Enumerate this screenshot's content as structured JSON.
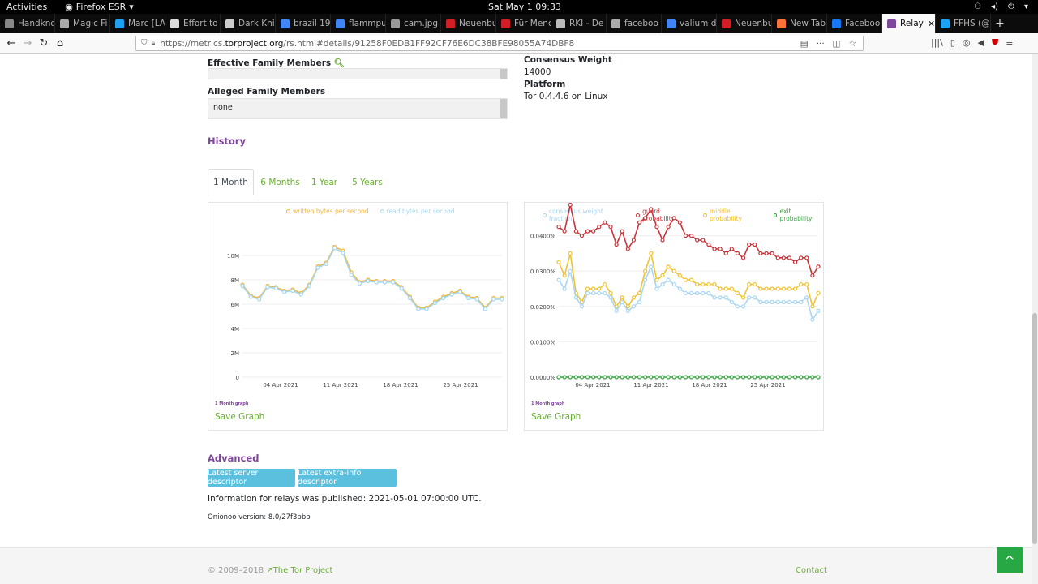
{
  "system": {
    "activities": "Activities",
    "app": "Firefox ESR",
    "clock": "Sat May 1  09:33"
  },
  "tabs": [
    {
      "label": "Handkno",
      "color": "#888"
    },
    {
      "label": "Magic Fi",
      "color": "#aaa"
    },
    {
      "label": "Marc [LA",
      "color": "#1da1f2"
    },
    {
      "label": "Effort to",
      "color": "#ddd"
    },
    {
      "label": "Dark Kni",
      "color": "#ccc"
    },
    {
      "label": "brazil 19",
      "color": "#4285f4"
    },
    {
      "label": "flammpu",
      "color": "#4285f4"
    },
    {
      "label": "cam.jpg (JPE",
      "color": "#999"
    },
    {
      "label": "Neuenbu",
      "color": "#d01f27"
    },
    {
      "label": "Für Menc",
      "color": "#d01f27"
    },
    {
      "label": "RKI - De",
      "color": "#bbb"
    },
    {
      "label": "faceboo",
      "color": "#aaa"
    },
    {
      "label": "valium d",
      "color": "#4285f4"
    },
    {
      "label": "Neuenbu",
      "color": "#d01f27"
    },
    {
      "label": "New Tab",
      "color": "#ff7139"
    },
    {
      "label": "Faceboo",
      "color": "#1877f2"
    },
    {
      "label": "Relay",
      "color": "#7d4698",
      "active": true
    },
    {
      "label": "FFHS (@",
      "color": "#1da1f2"
    }
  ],
  "newtab": "+",
  "url": {
    "prefix": "https://metrics.",
    "domain": "torproject.org",
    "rest": "/rs.html#details/91258F0EDB1FF92CF76E6DC38BFE98055A74DBF8"
  },
  "details": {
    "effective_family_label": "Effective Family Members",
    "alleged_family_label": "Alleged Family Members",
    "alleged_family_value": "none",
    "consensus_weight_label": "Consensus Weight",
    "consensus_weight_value": "14000",
    "platform_label": "Platform",
    "platform_value": "Tor 0.4.4.6 on Linux"
  },
  "history": {
    "title": "History",
    "tabs": [
      "1 Month",
      "6 Months",
      "1 Year",
      "5 Years"
    ]
  },
  "graph1": {
    "legend": [
      "written bytes per second",
      "read bytes per second"
    ],
    "label": "1 Month graph",
    "save": "Save Graph"
  },
  "graph2": {
    "legend": [
      "consensus weight fraction",
      "guard probability",
      "middle probability",
      "exit probability"
    ],
    "label": "1 Month graph",
    "save": "Save Graph"
  },
  "colors": {
    "written": "#f0b840",
    "read": "#a7d8f0",
    "guard": "#c8333a",
    "middle": "#f0c330",
    "exit": "#3aa643",
    "cwf": "#a9d6f2",
    "accent": "#7d4698",
    "link": "#68b030"
  },
  "chart_data": [
    {
      "type": "line",
      "x": [
        "2021-03-30",
        "2021-03-31",
        "2021-04-01",
        "2021-04-02",
        "2021-04-03",
        "2021-04-04",
        "2021-04-05",
        "2021-04-06",
        "2021-04-07",
        "2021-04-08",
        "2021-04-09",
        "2021-04-10",
        "2021-04-11",
        "2021-04-12",
        "2021-04-13",
        "2021-04-14",
        "2021-04-15",
        "2021-04-16",
        "2021-04-17",
        "2021-04-18",
        "2021-04-19",
        "2021-04-20",
        "2021-04-21",
        "2021-04-22",
        "2021-04-23",
        "2021-04-24",
        "2021-04-25",
        "2021-04-26",
        "2021-04-27",
        "2021-04-28",
        "2021-04-29",
        "2021-04-30"
      ],
      "series": [
        {
          "name": "written bytes per second",
          "values": [
            7.6,
            6.7,
            6.5,
            7.5,
            7.4,
            7.1,
            7.2,
            6.9,
            7.6,
            9.1,
            9.4,
            10.7,
            10.4,
            8.6,
            7.8,
            8.0,
            7.9,
            7.9,
            7.9,
            7.4,
            6.6,
            5.7,
            5.7,
            6.2,
            6.6,
            6.9,
            7.1,
            6.6,
            6.5,
            5.7,
            6.5,
            6.5
          ]
        },
        {
          "name": "read bytes per second",
          "values": [
            7.5,
            6.6,
            6.4,
            7.4,
            7.3,
            7.0,
            7.1,
            6.8,
            7.5,
            9.0,
            9.3,
            10.6,
            10.2,
            8.4,
            7.7,
            7.9,
            7.8,
            7.8,
            7.8,
            7.3,
            6.5,
            5.6,
            5.6,
            6.1,
            6.5,
            6.8,
            7.0,
            6.5,
            6.4,
            5.6,
            6.4,
            6.4
          ]
        }
      ],
      "ylabel_ticks": [
        "0",
        "2M",
        "4M",
        "6M",
        "8M",
        "10M"
      ],
      "ylim": [
        0,
        12
      ],
      "xticks": [
        "04 Apr 2021",
        "11 Apr 2021",
        "18 Apr 2021",
        "25 Apr 2021"
      ]
    },
    {
      "type": "line",
      "x_ticks": [
        "04 Apr 2021",
        "11 Apr 2021",
        "18 Apr 2021",
        "25 Apr 2021"
      ],
      "series": [
        {
          "name": "guard probability",
          "values": [
            0.034,
            0.033,
            0.039,
            0.033,
            0.032,
            0.033,
            0.033,
            0.034,
            0.035,
            0.034,
            0.03,
            0.033,
            0.029,
            0.031,
            0.035,
            0.036,
            0.038,
            0.034,
            0.031,
            0.034,
            0.036,
            0.035,
            0.032,
            0.032,
            0.031,
            0.031,
            0.03,
            0.029,
            0.029,
            0.028,
            0.029,
            0.028,
            0.027,
            0.03,
            0.03,
            0.028,
            0.028,
            0.028,
            0.027,
            0.027,
            0.027,
            0.026,
            0.027,
            0.027,
            0.023,
            0.025
          ]
        },
        {
          "name": "middle probability",
          "values": [
            0.026,
            0.023,
            0.028,
            0.019,
            0.017,
            0.02,
            0.02,
            0.02,
            0.021,
            0.019,
            0.016,
            0.018,
            0.016,
            0.018,
            0.019,
            0.024,
            0.028,
            0.022,
            0.023,
            0.025,
            0.024,
            0.023,
            0.022,
            0.022,
            0.021,
            0.021,
            0.021,
            0.021,
            0.02,
            0.02,
            0.02,
            0.019,
            0.018,
            0.021,
            0.021,
            0.02,
            0.02,
            0.02,
            0.02,
            0.02,
            0.02,
            0.02,
            0.021,
            0.021,
            0.016,
            0.019
          ]
        },
        {
          "name": "consensus weight fraction",
          "values": [
            0.022,
            0.02,
            0.024,
            0.018,
            0.016,
            0.019,
            0.019,
            0.019,
            0.019,
            0.018,
            0.015,
            0.017,
            0.015,
            0.016,
            0.017,
            0.022,
            0.025,
            0.02,
            0.021,
            0.022,
            0.021,
            0.02,
            0.019,
            0.019,
            0.019,
            0.019,
            0.019,
            0.018,
            0.018,
            0.018,
            0.017,
            0.016,
            0.016,
            0.018,
            0.018,
            0.017,
            0.017,
            0.017,
            0.017,
            0.017,
            0.017,
            0.017,
            0.017,
            0.018,
            0.013,
            0.015
          ]
        },
        {
          "name": "exit probability",
          "values": [
            0,
            0,
            0,
            0,
            0,
            0,
            0,
            0,
            0,
            0,
            0,
            0,
            0,
            0,
            0,
            0,
            0,
            0,
            0,
            0,
            0,
            0,
            0,
            0,
            0,
            0,
            0,
            0,
            0,
            0,
            0,
            0,
            0,
            0,
            0,
            0,
            0,
            0,
            0,
            0,
            0,
            0,
            0,
            0,
            0,
            0
          ]
        }
      ],
      "ylabel_ticks": [
        "0.0000%",
        "0.0100%",
        "0.0200%",
        "0.0300%",
        "0.0400%"
      ],
      "ylim": [
        0,
        0.04
      ]
    }
  ],
  "advanced": {
    "title": "Advanced",
    "btn1": "Latest server descriptor",
    "btn2": "Latest extra-info descriptor",
    "published": "Information for relays was published: 2021-05-01 07:00:00 UTC.",
    "onionoo": "Onionoo version: 8.0/27f3bbb"
  },
  "footer": {
    "copy": "© 2009–2018",
    "org": "The Tor Project",
    "contact": "Contact",
    "top": "^"
  }
}
